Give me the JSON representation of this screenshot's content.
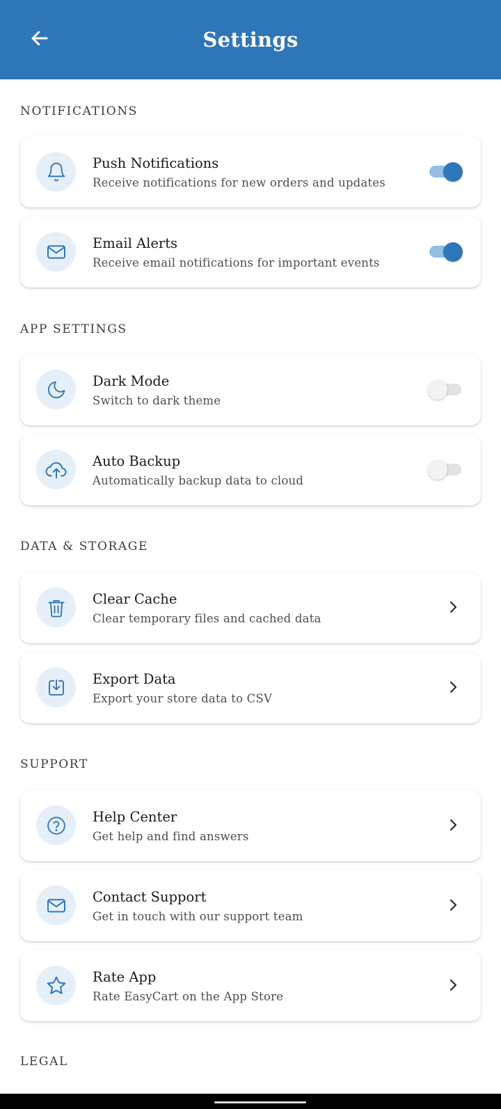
{
  "header": {
    "title": "Settings",
    "back_icon": "arrow-left-icon"
  },
  "sections": {
    "notifications": {
      "title": "NOTIFICATIONS",
      "items": [
        {
          "title": "Push Notifications",
          "subtitle": "Receive notifications for new orders and updates",
          "icon": "bell-icon",
          "toggle_on": true
        },
        {
          "title": "Email Alerts",
          "subtitle": "Receive email notifications for important events",
          "icon": "mail-icon",
          "toggle_on": true
        }
      ]
    },
    "app_settings": {
      "title": "APP SETTINGS",
      "items": [
        {
          "title": "Dark Mode",
          "subtitle": "Switch to dark theme",
          "icon": "moon-icon",
          "toggle_on": false
        },
        {
          "title": "Auto Backup",
          "subtitle": "Automatically backup data to cloud",
          "icon": "cloud-upload-icon",
          "toggle_on": false
        }
      ]
    },
    "data_storage": {
      "title": "DATA & STORAGE",
      "items": [
        {
          "title": "Clear Cache",
          "subtitle": "Clear temporary files and cached data",
          "icon": "trash-icon"
        },
        {
          "title": "Export Data",
          "subtitle": "Export your store data to CSV",
          "icon": "download-icon"
        }
      ]
    },
    "support": {
      "title": "SUPPORT",
      "items": [
        {
          "title": "Help Center",
          "subtitle": "Get help and find answers",
          "icon": "help-circle-icon"
        },
        {
          "title": "Contact Support",
          "subtitle": "Get in touch with our support team",
          "icon": "mail-icon"
        },
        {
          "title": "Rate App",
          "subtitle": "Rate EasyCart on the App Store",
          "icon": "star-icon"
        }
      ]
    },
    "legal": {
      "title": "LEGAL"
    }
  },
  "colors": {
    "primary": "#2f76b8",
    "icon_bg": "#e6eff8",
    "toggle_track_on": "#94bde3"
  }
}
